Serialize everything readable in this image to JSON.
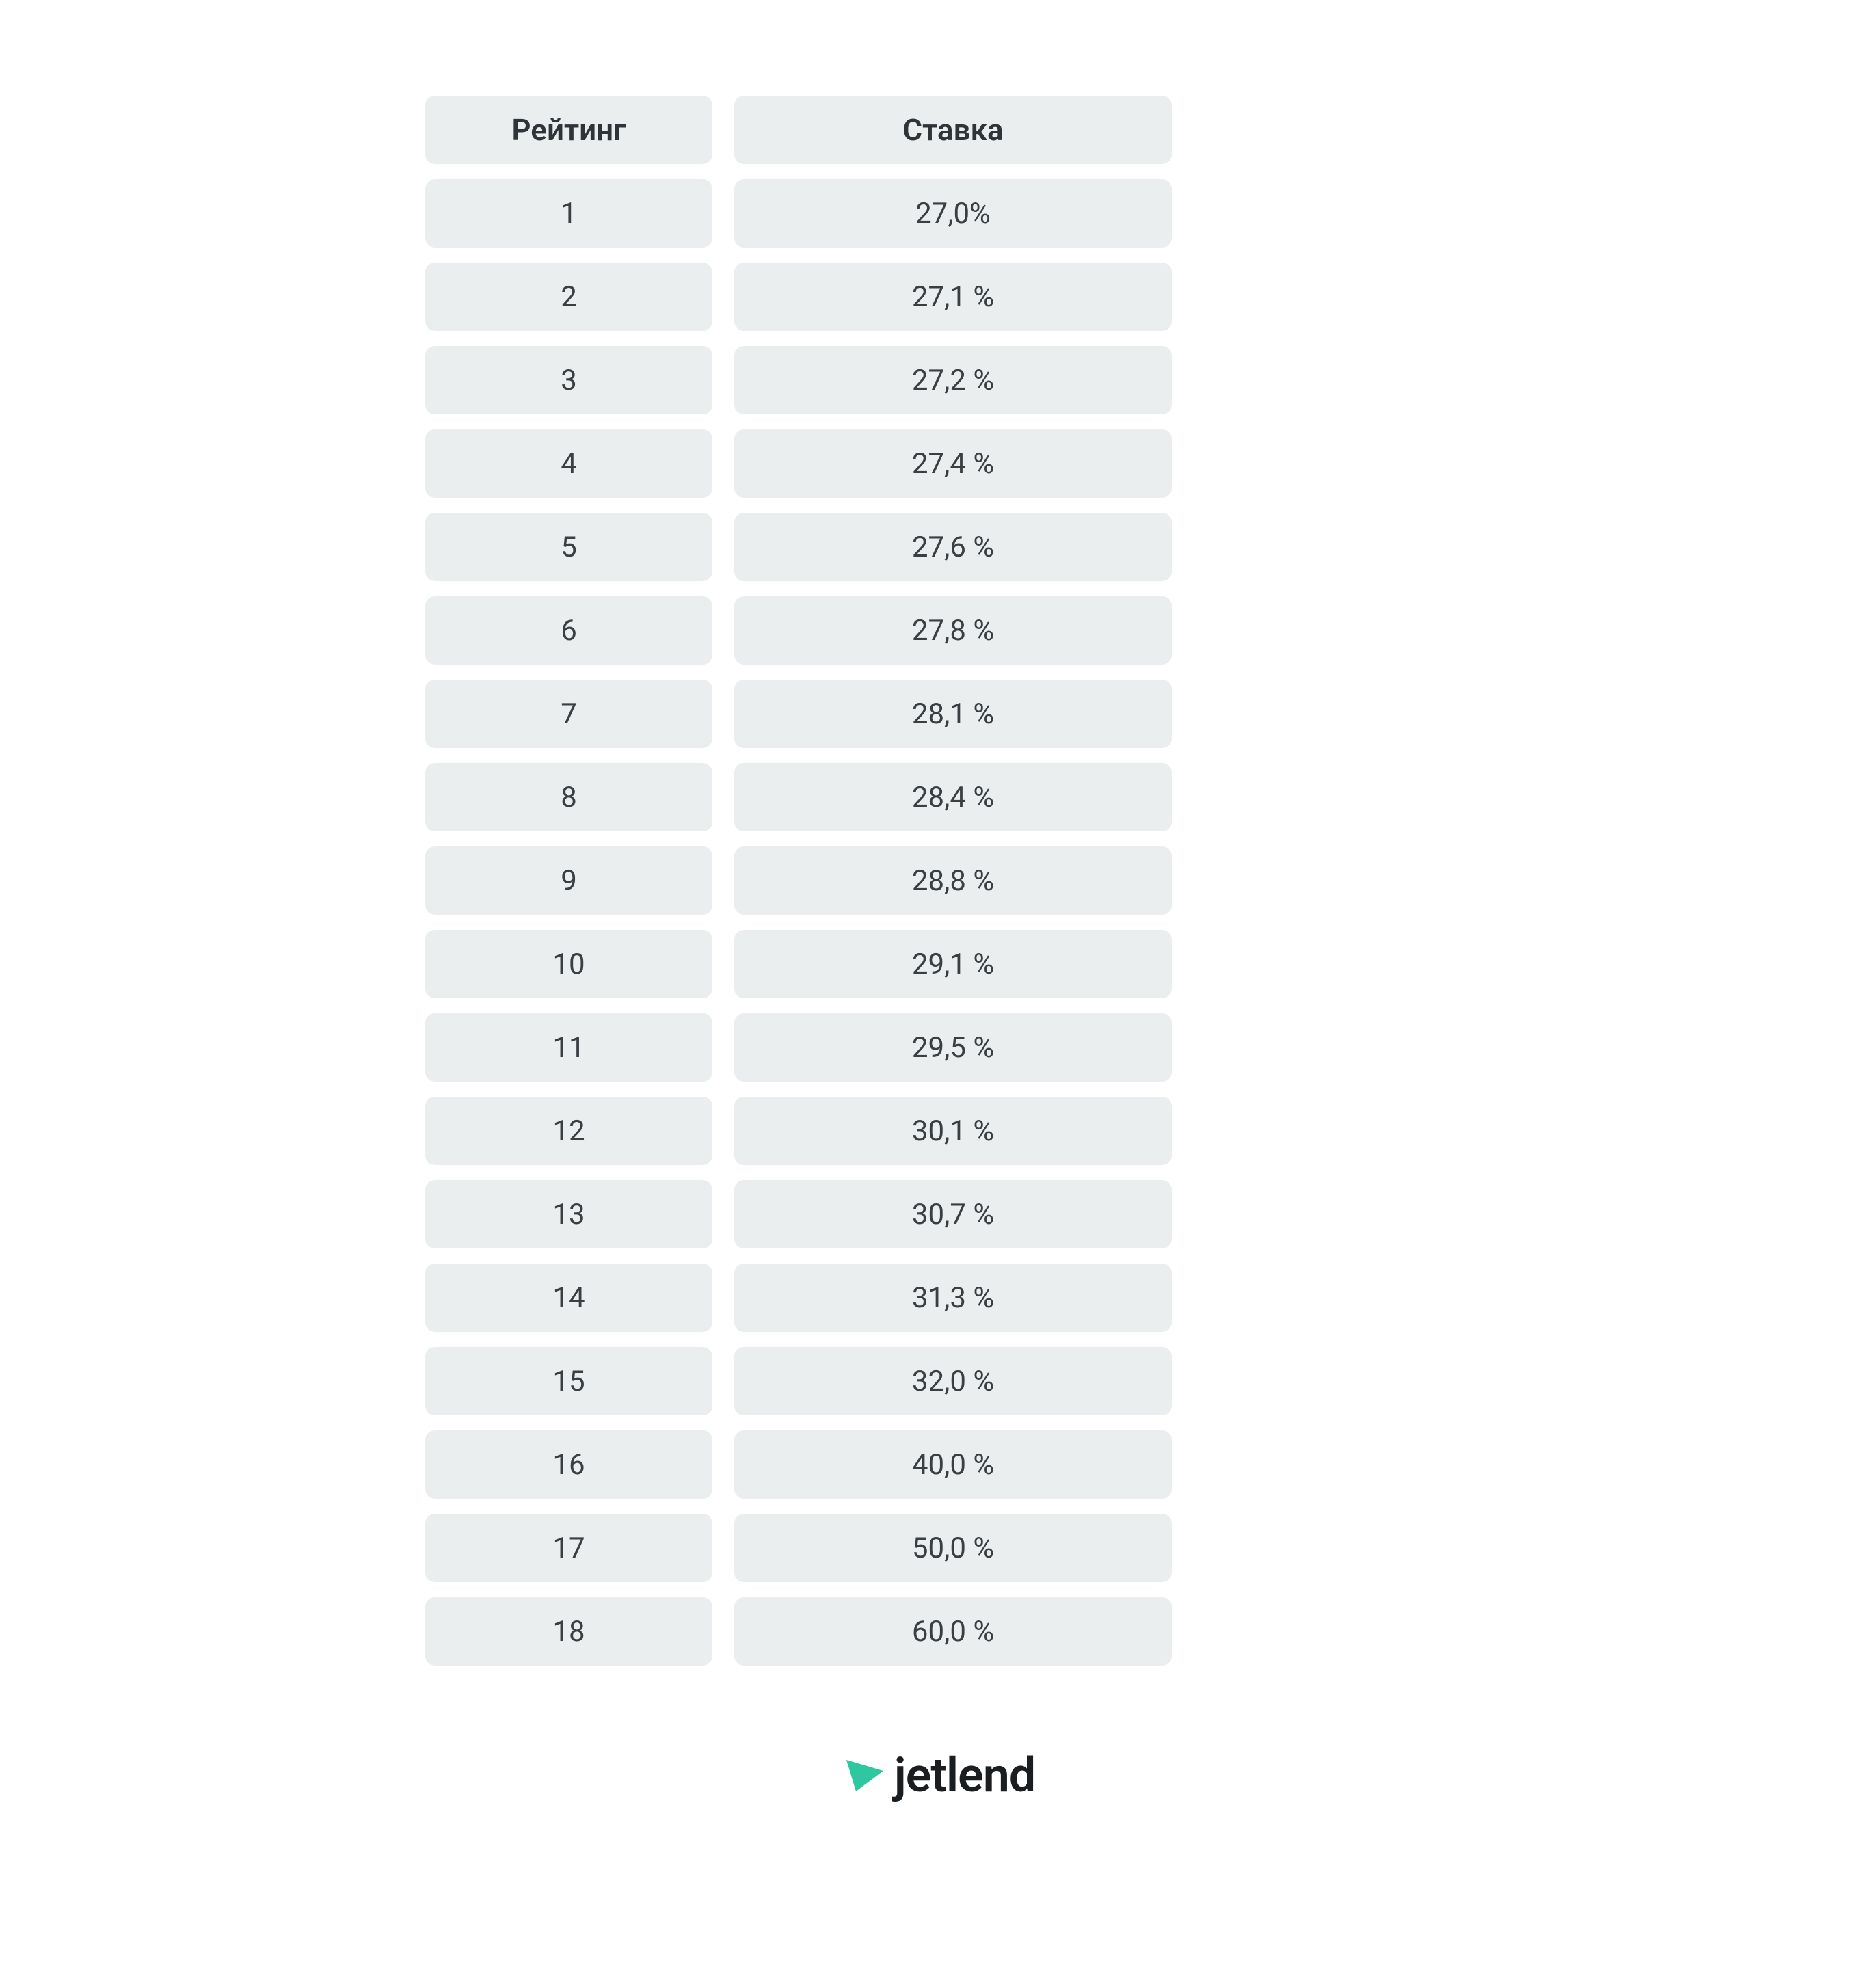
{
  "table": {
    "headers": {
      "rating": "Рейтинг",
      "rate": "Ставка"
    },
    "rows": [
      {
        "rating": "1",
        "rate": "27,0%"
      },
      {
        "rating": "2",
        "rate": "27,1 %"
      },
      {
        "rating": "3",
        "rate": "27,2 %"
      },
      {
        "rating": "4",
        "rate": "27,4 %"
      },
      {
        "rating": "5",
        "rate": "27,6 %"
      },
      {
        "rating": "6",
        "rate": "27,8 %"
      },
      {
        "rating": "7",
        "rate": "28,1 %"
      },
      {
        "rating": "8",
        "rate": "28,4 %"
      },
      {
        "rating": "9",
        "rate": "28,8 %"
      },
      {
        "rating": "10",
        "rate": "29,1 %"
      },
      {
        "rating": "11",
        "rate": "29,5 %"
      },
      {
        "rating": "12",
        "rate": "30,1 %"
      },
      {
        "rating": "13",
        "rate": "30,7 %"
      },
      {
        "rating": "14",
        "rate": "31,3 %"
      },
      {
        "rating": "15",
        "rate": "32,0 %"
      },
      {
        "rating": "16",
        "rate": "40,0 %"
      },
      {
        "rating": "17",
        "rate": "50,0 %"
      },
      {
        "rating": "18",
        "rate": "60,0 %"
      }
    ]
  },
  "brand": {
    "name": "jetlend",
    "accent_color": "#2fc79f"
  }
}
